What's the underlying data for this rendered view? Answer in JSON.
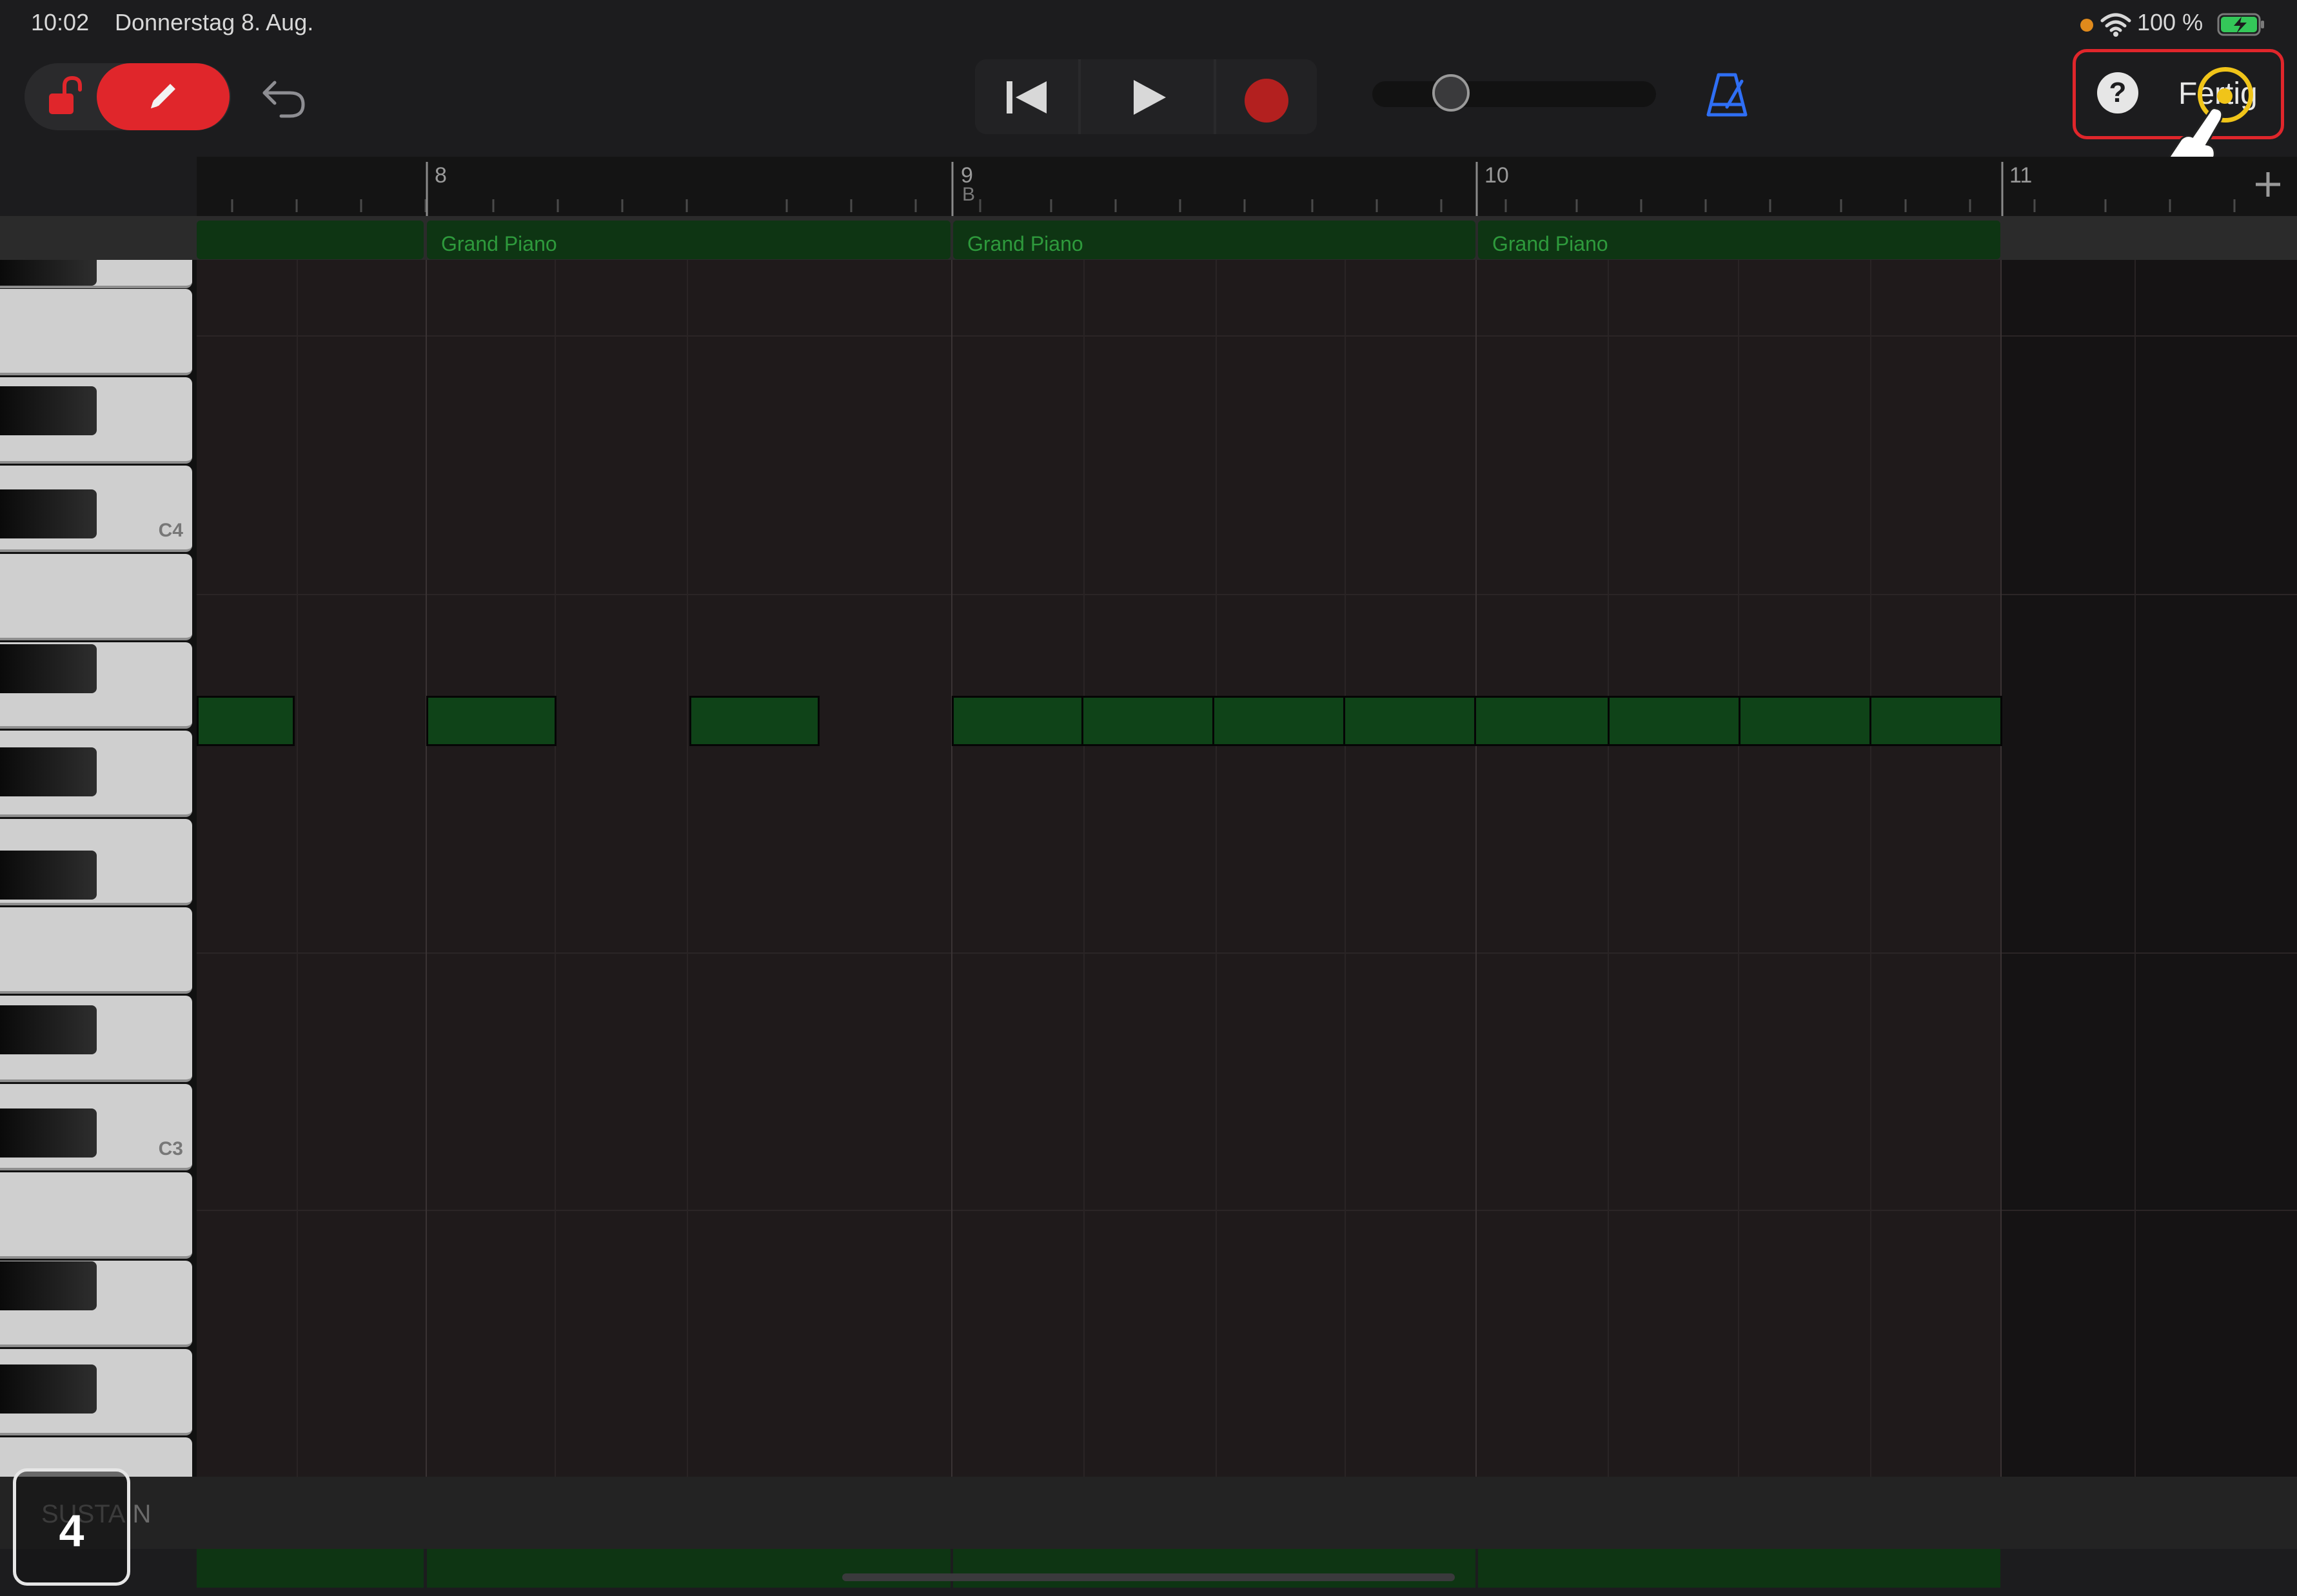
{
  "status_bar": {
    "time": "10:02",
    "date": "Donnerstag 8. Aug.",
    "battery": "100 %"
  },
  "toolbar": {
    "help_symbol": "?",
    "done_label": "Fertig"
  },
  "ruler": {
    "bars": [
      "8",
      "9",
      "10",
      "11"
    ],
    "marker": "B"
  },
  "regions": [
    {
      "label": ""
    },
    {
      "label": "Grand Piano"
    },
    {
      "label": "Grand Piano"
    },
    {
      "label": "Grand Piano"
    }
  ],
  "keyboard": {
    "labels": [
      "C4",
      "C3"
    ]
  },
  "sustain": {
    "label": "SUSTAIN"
  },
  "step_badge": "4",
  "colors": {
    "accent_red": "#e0262b",
    "region_green": "#0e3513",
    "note_green": "#0f4318",
    "metronome_blue": "#2f6ff5",
    "highlight_yellow": "#f0c419"
  },
  "icons": [
    "lock-open-icon",
    "pencil-icon",
    "undo-icon",
    "rewind-icon",
    "play-icon",
    "record-icon",
    "metronome-icon",
    "help-icon",
    "add-icon",
    "pointer-hand-icon"
  ]
}
